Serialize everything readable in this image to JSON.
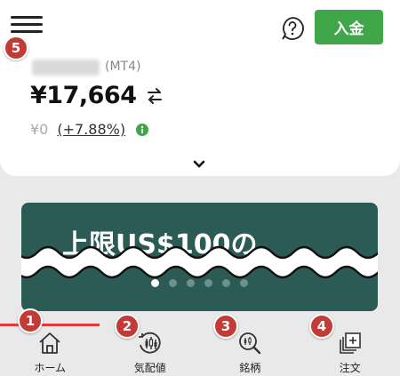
{
  "header": {
    "deposit_label": "入金",
    "help_icon": "question-circle-icon",
    "menu_icon": "hamburger-menu-icon"
  },
  "account": {
    "type": "(MT4)",
    "balance": "¥17,664",
    "pl_value": "¥0",
    "pl_percent": "(+7.88%)"
  },
  "banner": {
    "text": "上限US$100の",
    "slide_count": 6,
    "active_slide": 1
  },
  "tabs": [
    {
      "label": "ホーム",
      "icon": "home-icon",
      "active": true
    },
    {
      "label": "気配値",
      "icon": "quotes-icon",
      "active": false
    },
    {
      "label": "銘柄",
      "icon": "symbol-search-icon",
      "active": false
    },
    {
      "label": "注文",
      "icon": "order-icon",
      "active": false
    }
  ],
  "annotations": [
    "1",
    "2",
    "3",
    "4",
    "5"
  ],
  "colors": {
    "accent_green": "#3fa64a",
    "banner_bg": "#2c5b55",
    "active_tab_line": "#e03a3a",
    "badge": "#c23b36"
  }
}
